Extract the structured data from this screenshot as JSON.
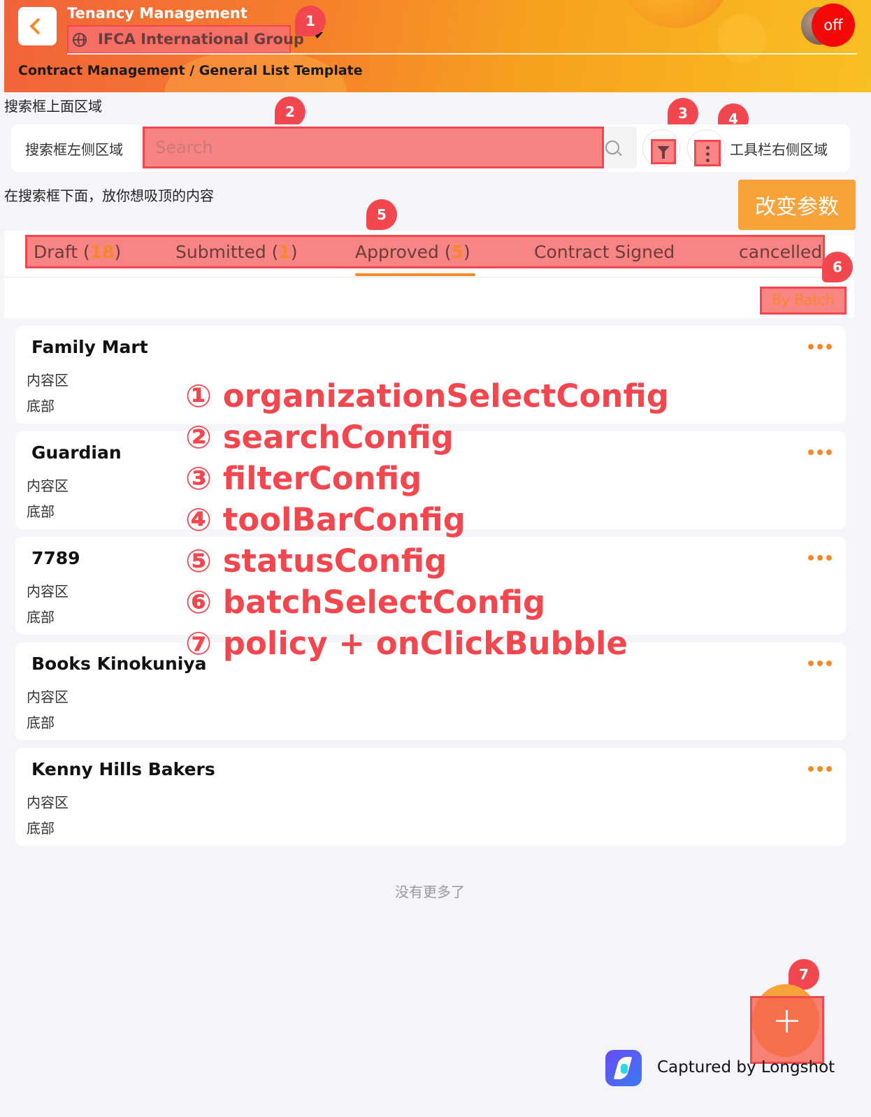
{
  "header": {
    "app_title": "Tenancy Management",
    "organization": "IFCA International Group",
    "breadcrumb": "Contract Management / General List Template",
    "status_badge": "off"
  },
  "markers": [
    "1",
    "2",
    "3",
    "4",
    "5",
    "6",
    "7"
  ],
  "search": {
    "top_area": "搜索框上面区域",
    "left_area": "搜索框左侧区域",
    "placeholder": "Search",
    "right_area": "工具栏右侧区域"
  },
  "sticky": {
    "text": "在搜索框下面，放你想吸顶的内容",
    "change_button": "改变参数"
  },
  "tabs": [
    {
      "label": "Draft (",
      "count": "18",
      "suffix": ")"
    },
    {
      "label": "Submitted (",
      "count": "1",
      "suffix": ")"
    },
    {
      "label": "Approved (",
      "count": "5",
      "suffix": ")"
    },
    {
      "label": "Contract Signed",
      "count": "",
      "suffix": ""
    },
    {
      "label": "cancelled",
      "count": "",
      "suffix": ""
    }
  ],
  "active_tab": "Approved",
  "batch_button": "By Batch",
  "cards": [
    {
      "title": "Family Mart",
      "content": "内容区",
      "footer": "底部"
    },
    {
      "title": "Guardian",
      "content": "内容区",
      "footer": "底部"
    },
    {
      "title": "7789",
      "content": "内容区",
      "footer": "底部"
    },
    {
      "title": "Books Kinokuniya",
      "content": "内容区",
      "footer": "底部"
    },
    {
      "title": "Kenny Hills Bakers",
      "content": "内容区",
      "footer": "底部"
    }
  ],
  "config_labels": [
    "① organizationSelectConfig",
    "② searchConfig",
    "③ filterConfig",
    "④ toolBarConfig",
    "⑤ statusConfig",
    "⑥ batchSelectConfig",
    "⑦ policy + onClickBubble"
  ],
  "no_more": "没有更多了",
  "watermark": "Captured by Longshot",
  "colors": {
    "accent": "#f5892a",
    "highlight": "#f2474f",
    "button": "#f8a23a"
  }
}
